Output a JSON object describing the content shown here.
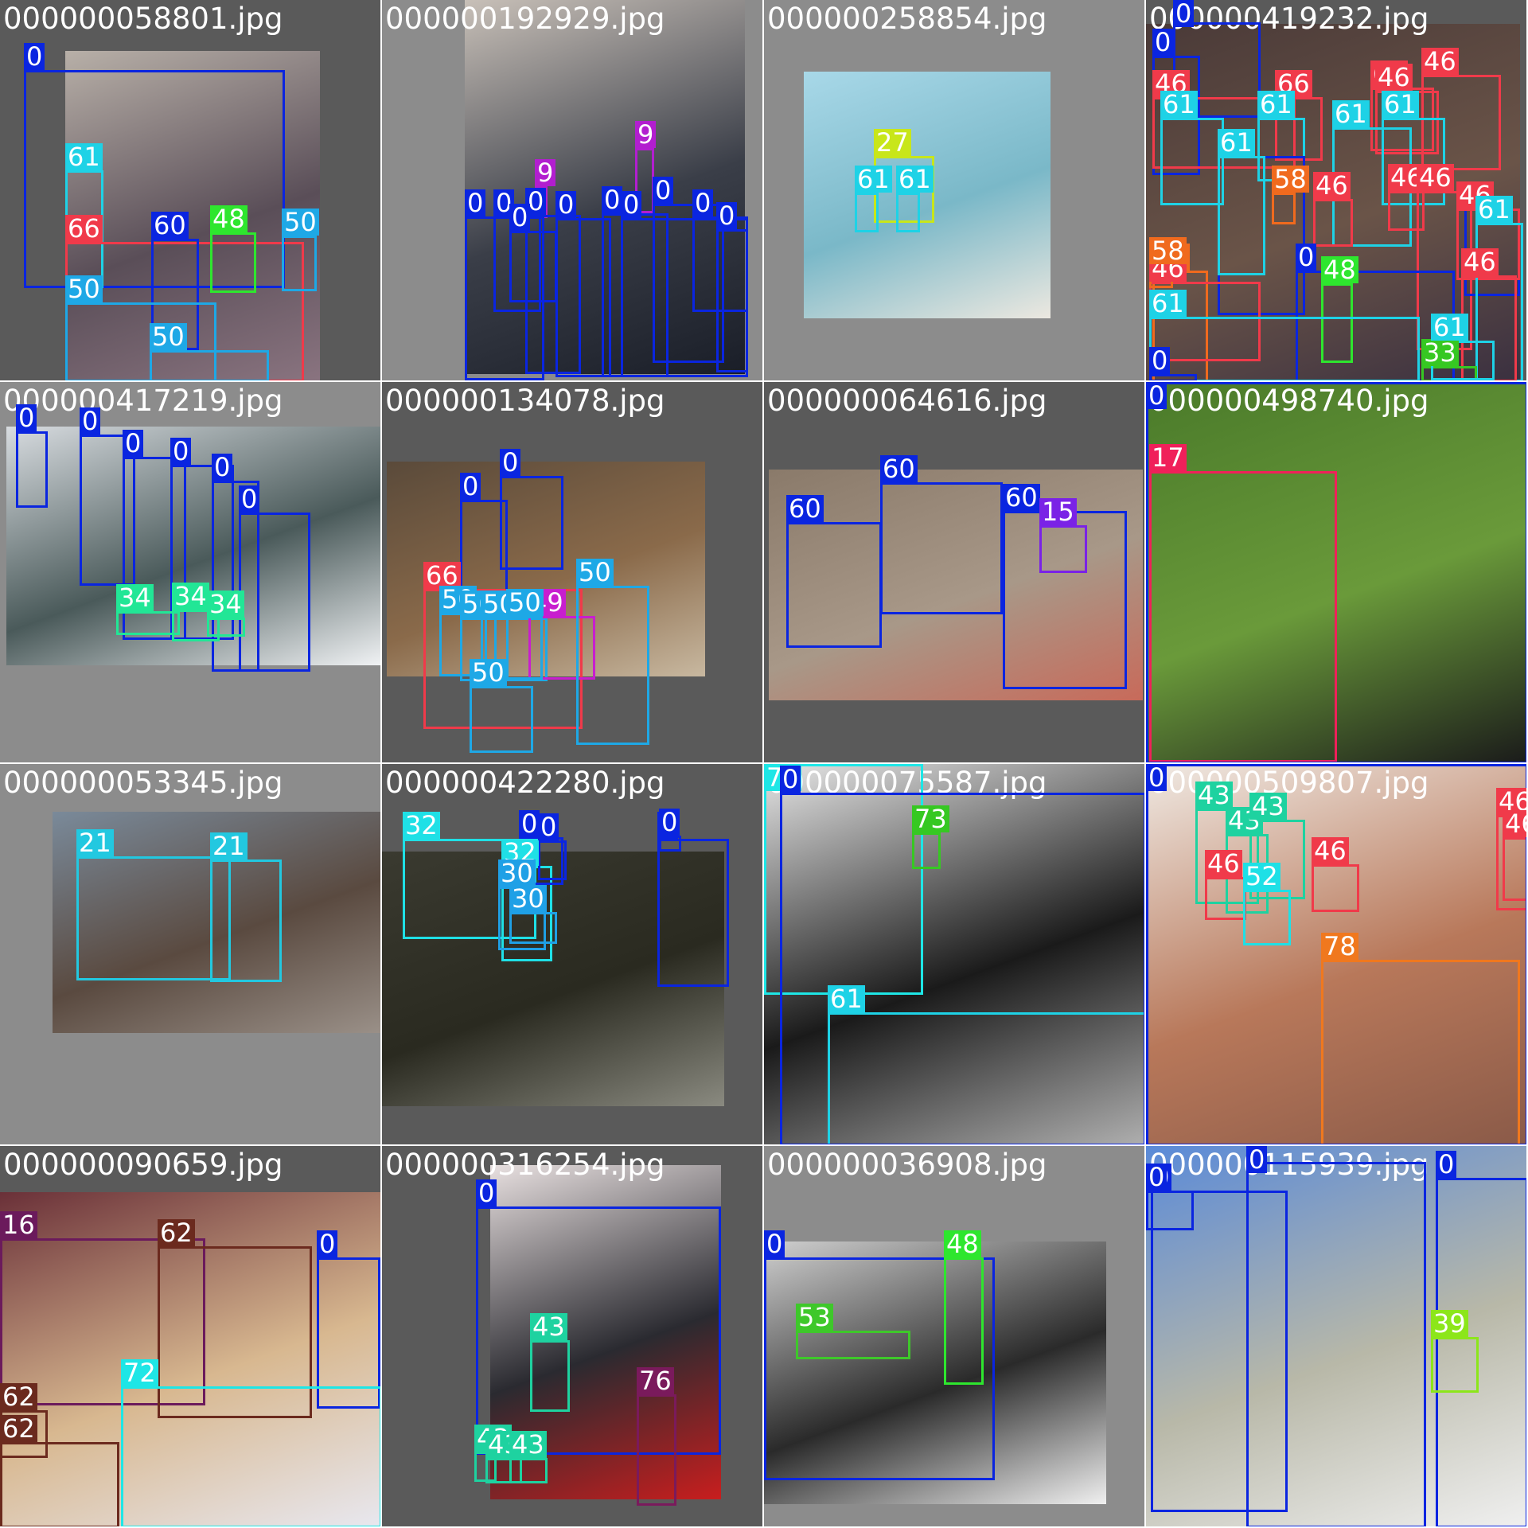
{
  "mosaic": {
    "rows": 4,
    "cols": 4,
    "tile_backgrounds": {
      "dark": "#5a5a5a",
      "light": "#8c8c8c"
    },
    "class_colors": {
      "0": "#0a25e0",
      "9": "#b21ecf",
      "15": "#7a22e6",
      "16": "#6b1a5c",
      "17": "#f0205a",
      "21": "#22c8e0",
      "27": "#c8e61a",
      "30": "#1fa0e6",
      "32": "#1fe0e6",
      "33": "#36c822",
      "34": "#22e696",
      "39": "#8ce61a",
      "43": "#1ed2a0",
      "46": "#f03a4a",
      "48": "#2ee62e",
      "49": "#c81ecf",
      "50": "#1ea8e6",
      "52": "#1ee0e6",
      "53": "#3ec82a",
      "58": "#f06a1e",
      "60": "#0a25e0",
      "61": "#1ed2e6",
      "62": "#6b2a1e",
      "66": "#f03a4a",
      "72": "#1ee6e6",
      "73": "#36c822",
      "76": "#7a1a5c",
      "78": "#f0781e"
    },
    "tiles": [
      {
        "filename": "000000058801.jpg",
        "bg": "dark",
        "photo_colors": [
          "#b8b0a8",
          "#5a4e58",
          "#8a7480"
        ],
        "boxes": [
          {
            "cls": "0"
          },
          {
            "cls": "61"
          },
          {
            "cls": "66"
          },
          {
            "cls": "60"
          },
          {
            "cls": "48"
          },
          {
            "cls": "50"
          },
          {
            "cls": "50"
          },
          {
            "cls": "50"
          }
        ]
      },
      {
        "filename": "000000192929.jpg",
        "bg": "light",
        "photo_colors": [
          "#c8c0b8",
          "#3a3e48",
          "#1a1e28"
        ],
        "boxes": [
          {
            "cls": "9"
          },
          {
            "cls": "9"
          },
          {
            "cls": "0"
          },
          {
            "cls": "0"
          },
          {
            "cls": "0"
          },
          {
            "cls": "0"
          },
          {
            "cls": "0"
          },
          {
            "cls": "0"
          },
          {
            "cls": "0"
          },
          {
            "cls": "0"
          },
          {
            "cls": "0"
          },
          {
            "cls": "0"
          }
        ]
      },
      {
        "filename": "000000258854.jpg",
        "bg": "light",
        "photo_colors": [
          "#a8d8e8",
          "#7ab8c8",
          "#ece8e0"
        ],
        "boxes": [
          {
            "cls": "27"
          },
          {
            "cls": "61"
          },
          {
            "cls": "61"
          }
        ]
      },
      {
        "filename": "000000419232.jpg",
        "bg": "dark",
        "photo_colors": [
          "#4a3a38",
          "#6a5448",
          "#3a3040"
        ],
        "boxes": [
          {
            "cls": "0"
          },
          {
            "cls": "0"
          },
          {
            "cls": "46"
          },
          {
            "cls": "66"
          },
          {
            "cls": "66"
          },
          {
            "cls": "46"
          },
          {
            "cls": "46"
          },
          {
            "cls": "61"
          },
          {
            "cls": "61"
          },
          {
            "cls": "61"
          },
          {
            "cls": "61"
          },
          {
            "cls": "0"
          },
          {
            "cls": "61"
          },
          {
            "cls": "58"
          },
          {
            "cls": "58"
          },
          {
            "cls": "46"
          },
          {
            "cls": "46"
          },
          {
            "cls": "46"
          },
          {
            "cls": "0"
          },
          {
            "cls": "46"
          },
          {
            "cls": "61"
          },
          {
            "cls": "0"
          },
          {
            "cls": "48"
          },
          {
            "cls": "46"
          },
          {
            "cls": "46"
          },
          {
            "cls": "61"
          },
          {
            "cls": "33"
          },
          {
            "cls": "0"
          },
          {
            "cls": "58"
          },
          {
            "cls": "61"
          }
        ]
      },
      {
        "filename": "000000417219.jpg",
        "bg": "light",
        "photo_colors": [
          "#d8dce0",
          "#4a5a5a",
          "#f0f2f4"
        ],
        "boxes": [
          {
            "cls": "0"
          },
          {
            "cls": "0"
          },
          {
            "cls": "0"
          },
          {
            "cls": "0"
          },
          {
            "cls": "0"
          },
          {
            "cls": "0"
          },
          {
            "cls": "34"
          },
          {
            "cls": "34"
          },
          {
            "cls": "34"
          }
        ]
      },
      {
        "filename": "000000134078.jpg",
        "bg": "dark",
        "photo_colors": [
          "#5a4a3a",
          "#8a6a4a",
          "#c8b8a0"
        ],
        "boxes": [
          {
            "cls": "0"
          },
          {
            "cls": "0"
          },
          {
            "cls": "66"
          },
          {
            "cls": "50"
          },
          {
            "cls": "50"
          },
          {
            "cls": "50"
          },
          {
            "cls": "49"
          },
          {
            "cls": "50"
          },
          {
            "cls": "50"
          },
          {
            "cls": "50"
          }
        ]
      },
      {
        "filename": "000000064616.jpg",
        "bg": "dark",
        "photo_colors": [
          "#8a7a6a",
          "#a89888",
          "#c86a5a"
        ],
        "boxes": [
          {
            "cls": "60"
          },
          {
            "cls": "60"
          },
          {
            "cls": "60"
          },
          {
            "cls": "15"
          }
        ]
      },
      {
        "filename": "000000498740.jpg",
        "bg": "dark",
        "photo_colors": [
          "#4a7a2a",
          "#6a9a3a",
          "#1a1a1a"
        ],
        "boxes": [
          {
            "cls": "17"
          },
          {
            "cls": "0"
          }
        ]
      },
      {
        "filename": "000000053345.jpg",
        "bg": "light",
        "photo_colors": [
          "#7a8a9a",
          "#5a4a40",
          "#9a9088"
        ],
        "boxes": [
          {
            "cls": "21"
          },
          {
            "cls": "21"
          }
        ]
      },
      {
        "filename": "000000422280.jpg",
        "bg": "dark",
        "photo_colors": [
          "#3a3a30",
          "#2a2a20",
          "#8a8a80"
        ],
        "boxes": [
          {
            "cls": "32"
          },
          {
            "cls": "32"
          },
          {
            "cls": "30"
          },
          {
            "cls": "30"
          },
          {
            "cls": "0"
          },
          {
            "cls": "0"
          },
          {
            "cls": "0"
          },
          {
            "cls": "0"
          }
        ]
      },
      {
        "filename": "000000075587.jpg",
        "bg": "dark",
        "photo_colors": [
          "#e8e8e8",
          "#1a1a1a",
          "#b0b0b0"
        ],
        "boxes": [
          {
            "cls": "72"
          },
          {
            "cls": "73"
          },
          {
            "cls": "61"
          },
          {
            "cls": "0"
          }
        ]
      },
      {
        "filename": "000000509807.jpg",
        "bg": "light",
        "photo_colors": [
          "#f0eae4",
          "#b8785a",
          "#8a5a48"
        ],
        "boxes": [
          {
            "cls": "43"
          },
          {
            "cls": "43"
          },
          {
            "cls": "43"
          },
          {
            "cls": "46"
          },
          {
            "cls": "52"
          },
          {
            "cls": "46"
          },
          {
            "cls": "46"
          },
          {
            "cls": "46"
          },
          {
            "cls": "78"
          },
          {
            "cls": "0"
          }
        ]
      },
      {
        "filename": "000000090659.jpg",
        "bg": "dark",
        "photo_colors": [
          "#6a3038",
          "#d8b890",
          "#e8e8f0"
        ],
        "boxes": [
          {
            "cls": "16"
          },
          {
            "cls": "62"
          },
          {
            "cls": "0"
          },
          {
            "cls": "72"
          },
          {
            "cls": "62"
          },
          {
            "cls": "62"
          }
        ]
      },
      {
        "filename": "000000316254.jpg",
        "bg": "dark",
        "photo_colors": [
          "#e8e0e0",
          "#2a2a30",
          "#c81e1e"
        ],
        "boxes": [
          {
            "cls": "0"
          },
          {
            "cls": "43"
          },
          {
            "cls": "76"
          },
          {
            "cls": "43"
          },
          {
            "cls": "43"
          },
          {
            "cls": "43"
          }
        ]
      },
      {
        "filename": "000000036908.jpg",
        "bg": "light",
        "photo_colors": [
          "#d0d0d0",
          "#2a2a2a",
          "#f0f0f0"
        ],
        "boxes": [
          {
            "cls": "0"
          },
          {
            "cls": "48"
          },
          {
            "cls": "53"
          }
        ]
      },
      {
        "filename": "000000115939.jpg",
        "bg": "light",
        "photo_colors": [
          "#5a8ad8",
          "#b8b8a8",
          "#f0f0f0"
        ],
        "boxes": [
          {
            "cls": "0"
          },
          {
            "cls": "0"
          },
          {
            "cls": "0"
          },
          {
            "cls": "0"
          },
          {
            "cls": "39"
          }
        ]
      }
    ]
  }
}
